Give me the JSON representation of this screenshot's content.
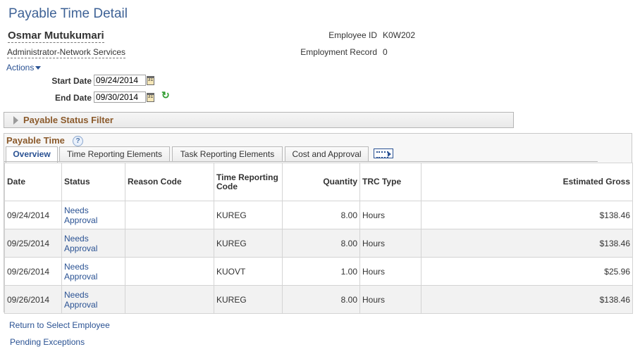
{
  "page": {
    "title": "Payable Time Detail"
  },
  "employee": {
    "name": "Osmar Mutukumari",
    "department": "Administrator-Network Services",
    "id_label": "Employee ID",
    "id_value": "K0W202",
    "record_label": "Employment Record",
    "record_value": "0"
  },
  "actions_label": "Actions",
  "dates": {
    "start_label": "Start Date",
    "start_value": "09/24/2014",
    "end_label": "End Date",
    "end_value": "09/30/2014",
    "calendar_glyph": "31"
  },
  "filter": {
    "label": "Payable Status Filter"
  },
  "grid": {
    "title": "Payable Time",
    "help_glyph": "?",
    "tabs": [
      {
        "label": "Overview"
      },
      {
        "label": "Time Reporting Elements"
      },
      {
        "label": "Task Reporting Elements"
      },
      {
        "label": "Cost and Approval"
      }
    ],
    "columns": [
      "Date",
      "Status",
      "Reason Code",
      "Time Reporting Code",
      "Quantity",
      "TRC Type",
      "Estimated Gross"
    ],
    "rows": [
      {
        "date": "09/24/2014",
        "status": "Needs Approval",
        "reason": "",
        "trc": "KUREG",
        "quantity": "8.00",
        "trc_type": "Hours",
        "gross": "$138.46"
      },
      {
        "date": "09/25/2014",
        "status": "Needs Approval",
        "reason": "",
        "trc": "KUREG",
        "quantity": "8.00",
        "trc_type": "Hours",
        "gross": "$138.46"
      },
      {
        "date": "09/26/2014",
        "status": "Needs Approval",
        "reason": "",
        "trc": "KUOVT",
        "quantity": "1.00",
        "trc_type": "Hours",
        "gross": "$25.96"
      },
      {
        "date": "09/26/2014",
        "status": "Needs Approval",
        "reason": "",
        "trc": "KUREG",
        "quantity": "8.00",
        "trc_type": "Hours",
        "gross": "$138.46"
      }
    ]
  },
  "footer": {
    "return_link": "Return to Select Employee",
    "pending_link": "Pending Exceptions"
  },
  "icons": {
    "calendar": "calendar-icon",
    "refresh": "refresh-icon",
    "help": "help-icon",
    "expand": "expand-triangle-icon",
    "tab_more": "show-all-columns-icon"
  },
  "colors": {
    "title": "#3e6296",
    "link": "#2a5293",
    "section_label": "#8b5a2b",
    "refresh": "#2e9c2e"
  }
}
